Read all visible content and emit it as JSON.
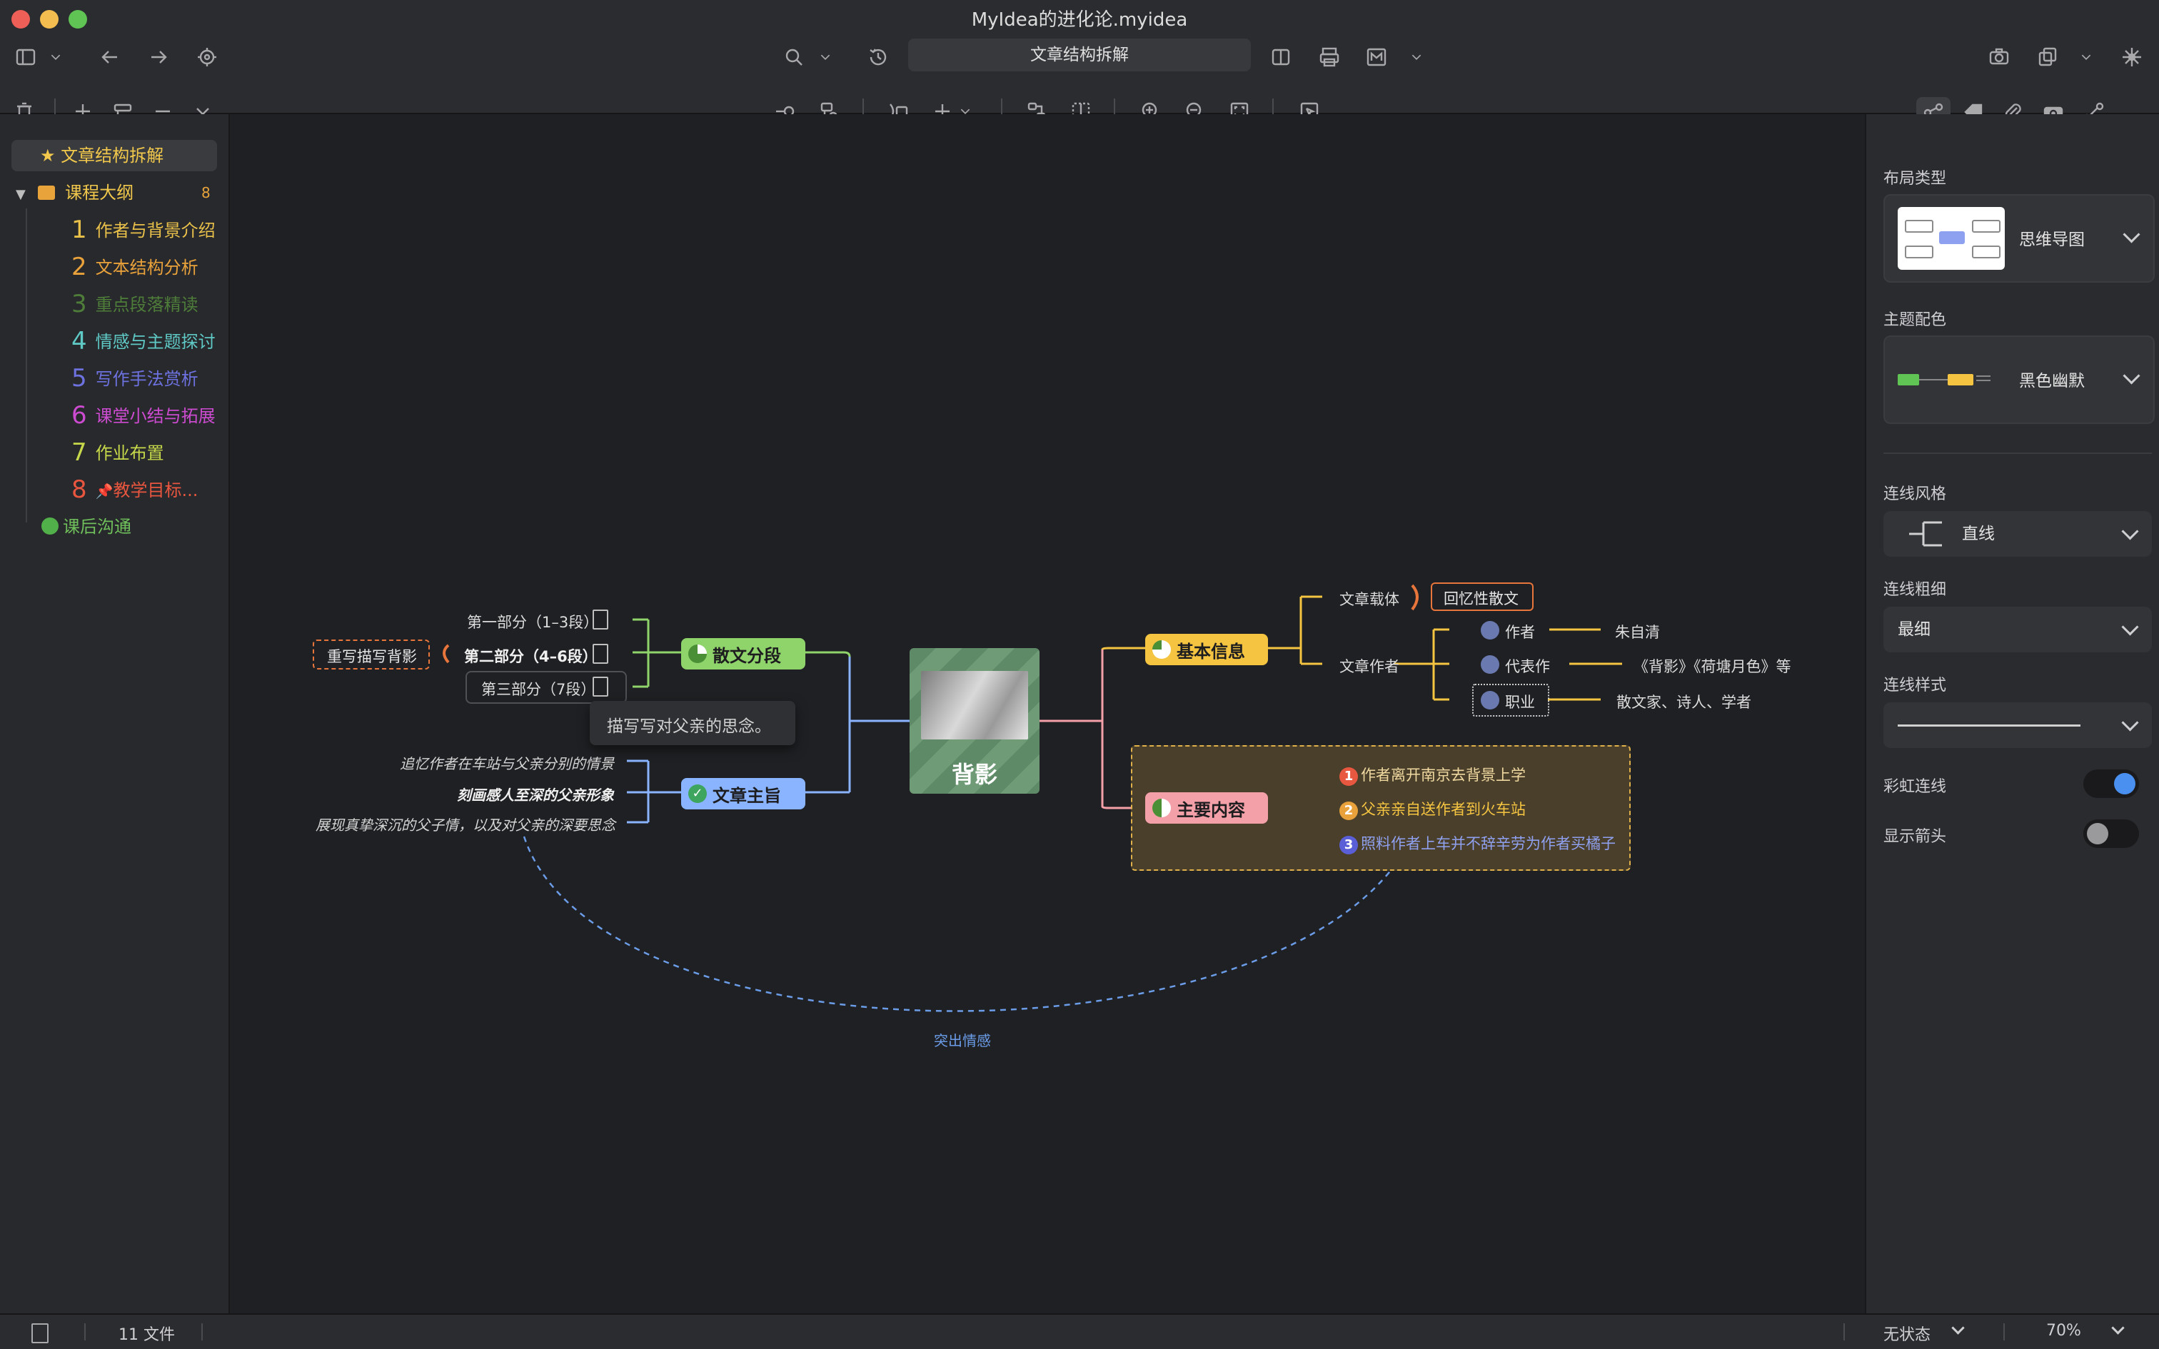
{
  "window": {
    "title": "MyIdea的进化论.myidea",
    "breadcrumb": "文章结构拆解"
  },
  "sidebar": {
    "favorite": "文章结构拆解",
    "folder": {
      "label": "课程大纲",
      "count": "8"
    },
    "items": [
      {
        "num": "1",
        "label": "作者与背景介绍",
        "color": "#e8c04a"
      },
      {
        "num": "2",
        "label": "文本结构分析",
        "color": "#e9a23b"
      },
      {
        "num": "3",
        "label": "重点段落精读",
        "color": "#4e7d3a"
      },
      {
        "num": "4",
        "label": "情感与主题探讨",
        "color": "#5fc9c6"
      },
      {
        "num": "5",
        "label": "写作手法赏析",
        "color": "#6d72e0"
      },
      {
        "num": "6",
        "label": "课堂小结与拓展",
        "color": "#cc4bd0"
      },
      {
        "num": "7",
        "label": "作业布置",
        "color": "#c7d94a"
      },
      {
        "num": "8",
        "label": "教学目标...",
        "color": "#e8563f"
      }
    ],
    "extra": "课后沟通"
  },
  "mindmap": {
    "center": "背影",
    "left": {
      "branch1": {
        "label": "散文分段",
        "children": [
          "第一部分（1–3段）",
          "第二部分（4–6段）",
          "第三部分（7段）"
        ],
        "callout": "重写描写背影",
        "tooltip": "描写写对父亲的思念。"
      },
      "branch2": {
        "label": "文章主旨",
        "children": [
          "追忆作者在车站与父亲分别的情景",
          "刻画感人至深的父亲形象",
          "展现真挚深沉的父子情，以及对父亲的深要思念"
        ]
      }
    },
    "right": {
      "branch1": {
        "label": "基本信息",
        "carrier_label": "文章载体",
        "carrier_value": "回忆性散文",
        "author_label": "文章作者",
        "author_rows": [
          {
            "label": "作者",
            "value": "朱自清"
          },
          {
            "label": "代表作",
            "value": "《背影》《荷塘月色》等"
          },
          {
            "label": "职业",
            "value": "散文家、诗人、学者"
          }
        ]
      },
      "branch2": {
        "label": "主要内容",
        "items": [
          {
            "n": "1",
            "text": "作者离开南京去背景上学",
            "color": "#e8573f"
          },
          {
            "n": "2",
            "text": "父亲亲自送作者到火车站",
            "color": "#e9a23b"
          },
          {
            "n": "3",
            "text": "照料作者上车并不辞辛劳为作者买橘子",
            "color": "#5a5fd8"
          }
        ]
      }
    },
    "relation_label": "突出情感"
  },
  "inspector": {
    "layout_type_label": "布局类型",
    "layout_type_value": "思维导图",
    "theme_label": "主题配色",
    "theme_value": "黑色幽默",
    "line_style_label": "连线风格",
    "line_style_value": "直线",
    "line_weight_label": "连线粗细",
    "line_weight_value": "最细",
    "line_pattern_label": "连线样式",
    "rainbow_label": "彩虹连线",
    "rainbow_on": true,
    "arrow_label": "显示箭头",
    "arrow_on": false
  },
  "status": {
    "files": "11 文件",
    "state": "无状态",
    "zoom": "70%"
  },
  "colors": {
    "accent_blue": "#4a90f0",
    "branch_green": "#8fd36b",
    "branch_blue": "#8ab4ff",
    "branch_yellow": "#f5c542",
    "branch_pink": "#f4a0a8",
    "main_content_fill": "#4a3f2a"
  }
}
